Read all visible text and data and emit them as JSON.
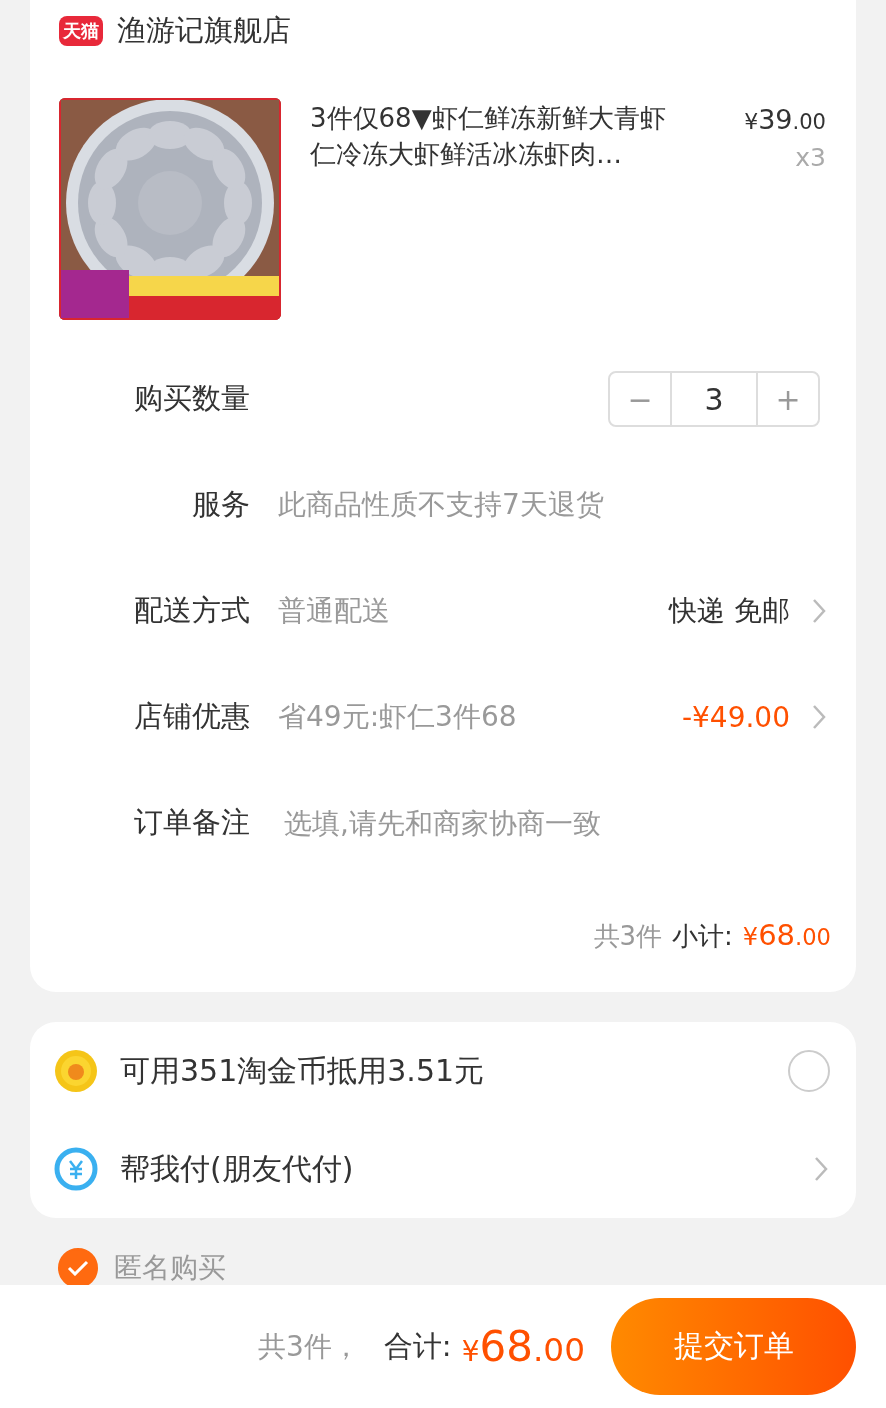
{
  "store": {
    "badge": "天猫",
    "name": "渔游记旗舰店"
  },
  "product": {
    "title": "3件仅68▼虾仁鲜冻新鲜大青虾仁冷冻大虾鲜活冰冻虾肉…",
    "price": {
      "currency": "¥",
      "integer": "39",
      "decimal": ".00"
    },
    "count": "x3"
  },
  "quantity": {
    "label": "购买数量",
    "minus": "−",
    "value": "3",
    "plus": "+"
  },
  "rows": [
    {
      "kind": "text",
      "label": "服务",
      "value": "此商品性质不支持7天退货"
    },
    {
      "kind": "link",
      "label": "配送方式",
      "value": "普通配送",
      "detail": "快递 免邮"
    },
    {
      "kind": "discount",
      "label": "店铺优惠",
      "value": "省49元:虾仁3件68",
      "detail": "-¥49.00"
    },
    {
      "kind": "input",
      "label": "订单备注",
      "placeholder": "选填,请先和商家协商一致"
    }
  ],
  "subtotal": {
    "count": "共3件",
    "label": "小计:",
    "currency": "¥",
    "integer": "68",
    "decimal": ".00"
  },
  "payment_options": [
    {
      "kind": "coin",
      "label": "可用351淘金币抵用3.51元",
      "checked": false
    },
    {
      "kind": "friend",
      "label": "帮我付(朋友代付)"
    }
  ],
  "anonymous": {
    "label": "匿名购买",
    "checked": true
  },
  "footer": {
    "count": "共3件，",
    "label": "合计:",
    "currency": "¥",
    "integer": "68",
    "decimal": ".00",
    "button": "提交订单"
  }
}
